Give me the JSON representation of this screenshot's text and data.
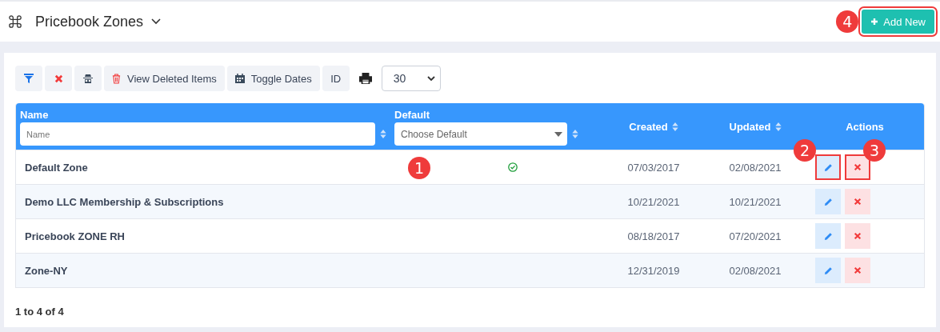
{
  "header": {
    "title": "Pricebook Zones",
    "add_button": {
      "label": "Add New",
      "highlighted": true,
      "callout": "4"
    }
  },
  "toolbar": {
    "buttons": [
      {
        "kind": "filter"
      },
      {
        "kind": "clear"
      },
      {
        "kind": "spy"
      },
      {
        "kind": "trash",
        "label": "View Deleted Items"
      },
      {
        "kind": "calendar",
        "label": "Toggle Dates"
      },
      {
        "kind": "text",
        "label": "ID"
      },
      {
        "kind": "print"
      }
    ],
    "page_size": "30"
  },
  "table": {
    "columns": [
      {
        "title": "Name",
        "filter": {
          "kind": "input",
          "placeholder": "Name"
        },
        "sortable": true
      },
      {
        "title": "Default",
        "filter": {
          "kind": "select",
          "placeholder": "Choose Default"
        },
        "sortable": true
      },
      {
        "title": "Created",
        "sortable": true
      },
      {
        "title": "Updated",
        "sortable": true
      },
      {
        "title": "Actions",
        "sortable": false
      }
    ],
    "rows": [
      {
        "name": "Default Zone",
        "default": true,
        "default_callout": "1",
        "created": "07/03/2017",
        "updated": "02/08/2021",
        "edit": {
          "highlighted": true,
          "callout": "2"
        },
        "delete": {
          "highlighted": true,
          "callout": "3"
        }
      },
      {
        "name": "Demo LLC Membership & Subscriptions",
        "default": false,
        "created": "10/21/2021",
        "updated": "10/21/2021",
        "edit": {
          "highlighted": false
        },
        "delete": {
          "highlighted": false
        }
      },
      {
        "name": "Pricebook ZONE RH",
        "default": false,
        "created": "08/18/2017",
        "updated": "07/20/2021",
        "edit": {
          "highlighted": false
        },
        "delete": {
          "highlighted": false
        }
      },
      {
        "name": "Zone-NY",
        "default": false,
        "created": "12/31/2019",
        "updated": "02/08/2021",
        "edit": {
          "highlighted": false
        },
        "delete": {
          "highlighted": false
        }
      }
    ]
  },
  "footer": "1 to 4 of 4"
}
